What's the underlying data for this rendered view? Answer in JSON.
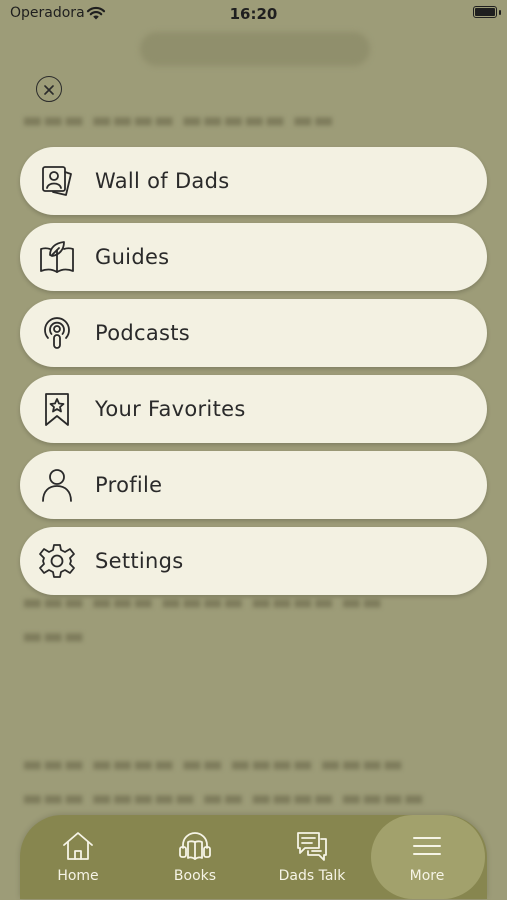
{
  "status_bar": {
    "carrier": "Operadora",
    "time": "16:20"
  },
  "close_button": {
    "icon": "close-icon"
  },
  "menu": [
    {
      "label": "Wall of Dads",
      "icon": "photo-album-icon"
    },
    {
      "label": "Guides",
      "icon": "book-leaf-icon"
    },
    {
      "label": "Podcasts",
      "icon": "podcast-icon"
    },
    {
      "label": "Your Favorites",
      "icon": "bookmark-star-icon"
    },
    {
      "label": "Profile",
      "icon": "person-icon"
    },
    {
      "label": "Settings",
      "icon": "gear-icon"
    }
  ],
  "tabbar": [
    {
      "label": "Home",
      "icon": "home-icon",
      "active": false
    },
    {
      "label": "Books",
      "icon": "headphones-book-icon",
      "active": false
    },
    {
      "label": "Dads Talk",
      "icon": "chat-bubbles-icon",
      "active": false
    },
    {
      "label": "More",
      "icon": "menu-icon",
      "active": true
    }
  ],
  "colors": {
    "overlay": "#9d9c78",
    "menu_item": "#f3f1e2",
    "tabbar": "#87864f",
    "tab_active": "#a2a16c"
  }
}
